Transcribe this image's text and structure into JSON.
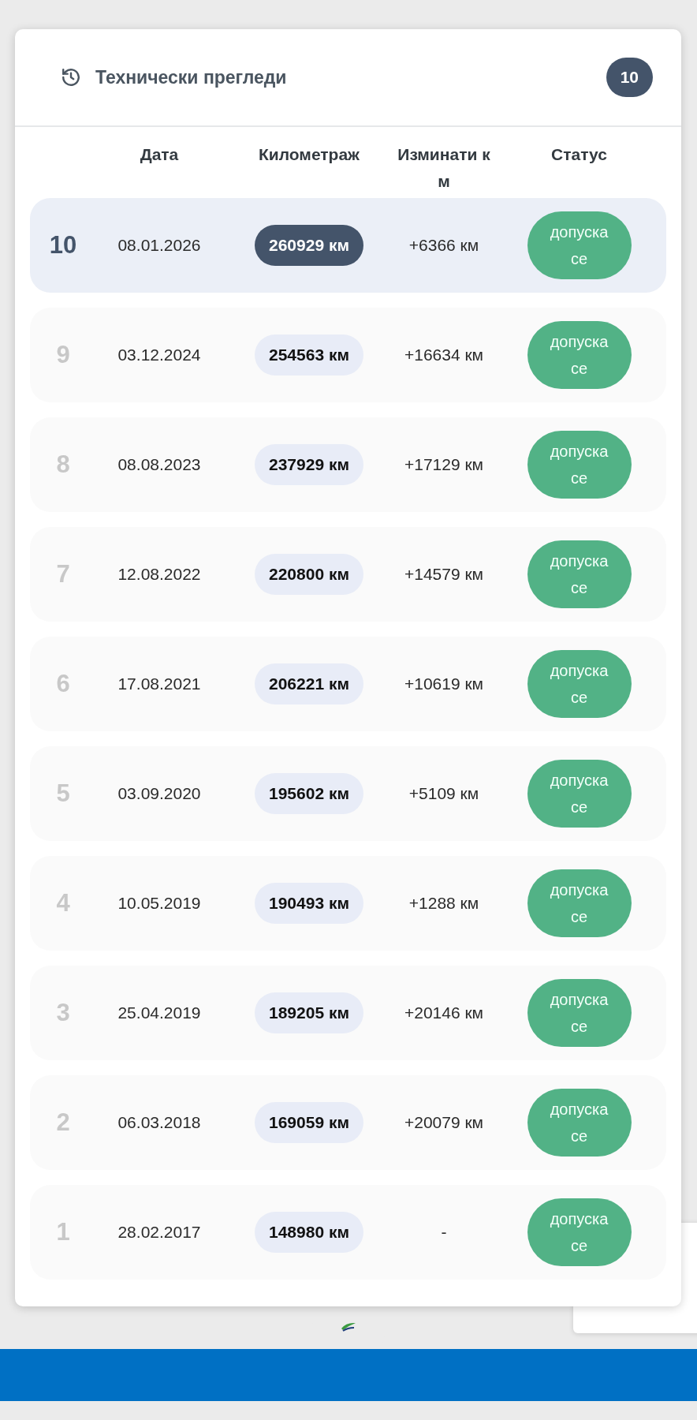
{
  "panel": {
    "title": "Технически прегледи",
    "count": "10"
  },
  "columns": [
    "Дата",
    "Километраж",
    "Изминати км",
    "Статус"
  ],
  "rows": [
    {
      "number": "10",
      "date": "08.01.2026",
      "mileage": "260929 км",
      "passed": "+6366 км",
      "status": "допуска се",
      "selected": true
    },
    {
      "number": "9",
      "date": "03.12.2024",
      "mileage": "254563 км",
      "passed": "+16634 км",
      "status": "допуска се",
      "selected": false
    },
    {
      "number": "8",
      "date": "08.08.2023",
      "mileage": "237929 км",
      "passed": "+17129 км",
      "status": "допуска се",
      "selected": false
    },
    {
      "number": "7",
      "date": "12.08.2022",
      "mileage": "220800 км",
      "passed": "+14579 км",
      "status": "допуска се",
      "selected": false
    },
    {
      "number": "6",
      "date": "17.08.2021",
      "mileage": "206221 км",
      "passed": "+10619 км",
      "status": "допуска се",
      "selected": false
    },
    {
      "number": "5",
      "date": "03.09.2020",
      "mileage": "195602 км",
      "passed": "+5109 км",
      "status": "допуска се",
      "selected": false
    },
    {
      "number": "4",
      "date": "10.05.2019",
      "mileage": "190493 км",
      "passed": "+1288 км",
      "status": "допуска се",
      "selected": false
    },
    {
      "number": "3",
      "date": "25.04.2019",
      "mileage": "189205 км",
      "passed": "+20146 км",
      "status": "допуска се",
      "selected": false
    },
    {
      "number": "2",
      "date": "06.03.2018",
      "mileage": "169059 км",
      "passed": "+20079 км",
      "status": "допуска се",
      "selected": false
    },
    {
      "number": "1",
      "date": "28.02.2017",
      "mileage": "148980 км",
      "passed": "-",
      "status": "допуска се",
      "selected": false
    }
  ]
}
